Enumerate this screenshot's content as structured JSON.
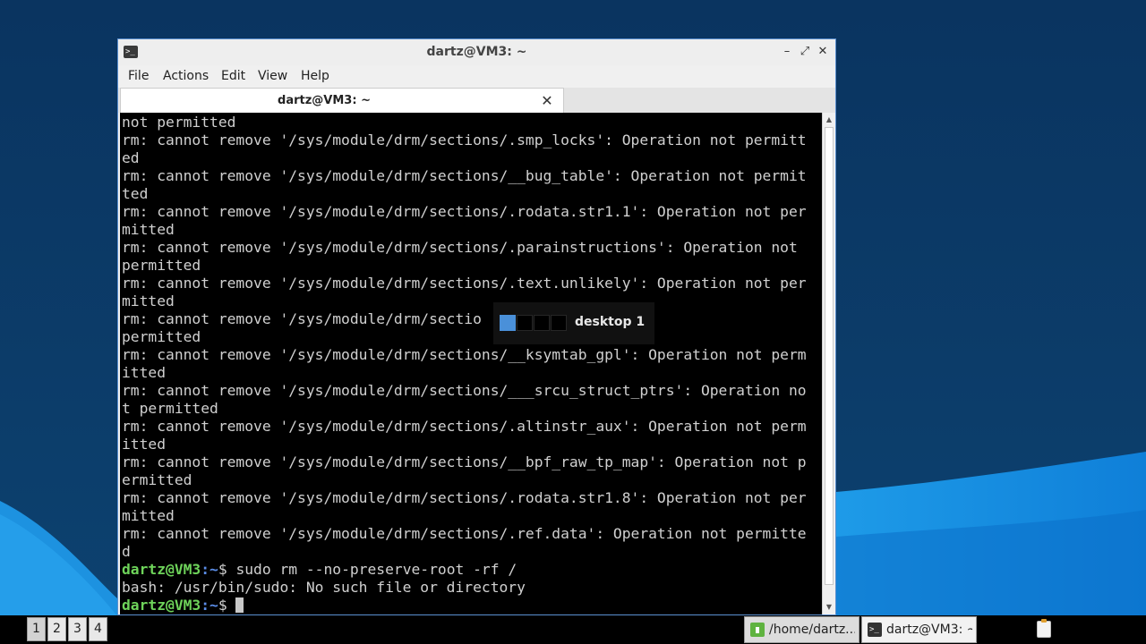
{
  "window": {
    "title": "dartz@VM3: ~",
    "icon": "terminal-icon",
    "controls": {
      "minimize": "–",
      "maximize": "⤢",
      "close": "✕"
    }
  },
  "menubar": {
    "items": [
      {
        "label": "File"
      },
      {
        "label": "Actions"
      },
      {
        "label": "Edit"
      },
      {
        "label": "View"
      },
      {
        "label": "Help"
      }
    ]
  },
  "tabs": [
    {
      "label": "dartz@VM3: ~",
      "close": "✕"
    }
  ],
  "terminal": {
    "lines": [
      {
        "text": "not permitted"
      },
      {
        "text": "rm: cannot remove '/sys/module/drm/sections/.smp_locks': Operation not permitt"
      },
      {
        "text": "ed"
      },
      {
        "text": "rm: cannot remove '/sys/module/drm/sections/__bug_table': Operation not permit"
      },
      {
        "text": "ted"
      },
      {
        "text": "rm: cannot remove '/sys/module/drm/sections/.rodata.str1.1': Operation not per"
      },
      {
        "text": "mitted"
      },
      {
        "text": "rm: cannot remove '/sys/module/drm/sections/.parainstructions': Operation not"
      },
      {
        "text": "permitted"
      },
      {
        "text": "rm: cannot remove '/sys/module/drm/sections/.text.unlikely': Operation not per"
      },
      {
        "text": "mitted"
      },
      {
        "text": "rm: cannot remove '/sys/module/drm/sectio"
      },
      {
        "text": "permitted"
      },
      {
        "text": "rm: cannot remove '/sys/module/drm/sections/__ksymtab_gpl': Operation not perm"
      },
      {
        "text": "itted"
      },
      {
        "text": "rm: cannot remove '/sys/module/drm/sections/___srcu_struct_ptrs': Operation no"
      },
      {
        "text": "t permitted"
      },
      {
        "text": "rm: cannot remove '/sys/module/drm/sections/.altinstr_aux': Operation not perm"
      },
      {
        "text": "itted"
      },
      {
        "text": "rm: cannot remove '/sys/module/drm/sections/__bpf_raw_tp_map': Operation not p"
      },
      {
        "text": "ermitted"
      },
      {
        "text": "rm: cannot remove '/sys/module/drm/sections/.rodata.str1.8': Operation not per"
      },
      {
        "text": "mitted"
      },
      {
        "text": "rm: cannot remove '/sys/module/drm/sections/.ref.data': Operation not permitte"
      },
      {
        "text": "d"
      },
      {
        "prompt_user": "dartz@VM3",
        "prompt_path": ":~",
        "prompt_sym": "$ ",
        "text": "sudo rm --no-preserve-root -rf /"
      },
      {
        "text": "bash: /usr/bin/sudo: No such file or directory"
      },
      {
        "prompt_user": "dartz@VM3",
        "prompt_path": ":~",
        "prompt_sym": "$ ",
        "text": "",
        "cursor": true
      }
    ]
  },
  "scrollbar": {
    "up": "▲",
    "down": "▼",
    "position": 1.0
  },
  "osd": {
    "label": "desktop 1",
    "desktops": 4,
    "active_index": 0
  },
  "taskbar": {
    "pager": [
      "1",
      "2",
      "3",
      "4"
    ],
    "active_desktop": 0,
    "tasks": [
      {
        "label": "/home/dartz...",
        "icon": "file-manager-icon"
      },
      {
        "label": "dartz@VM3: ~",
        "icon": "terminal-icon",
        "active": true
      }
    ],
    "tray": {
      "icon": "clipboard-icon"
    }
  },
  "colors": {
    "accent": "#4a90d9",
    "prompt_user": "#6ed35a",
    "prompt_path": "#5b8de8",
    "terminal_bg": "#000000",
    "terminal_fg": "#d0d0d0"
  }
}
